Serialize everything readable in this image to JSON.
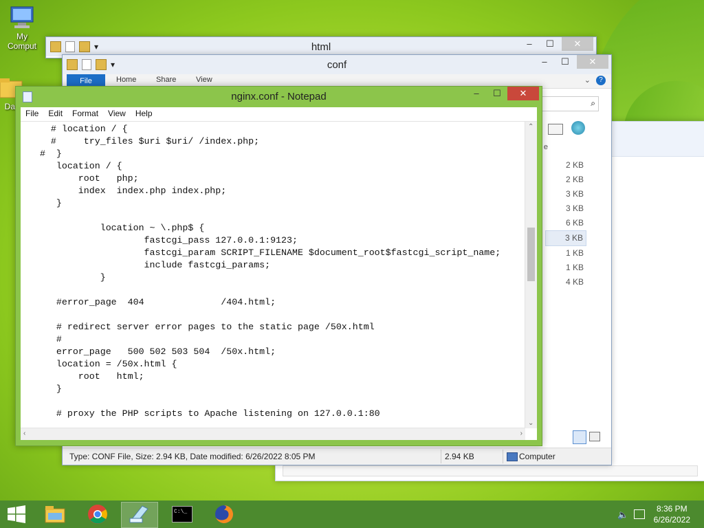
{
  "desktop": {
    "icons": [
      {
        "label": "My Comput",
        "icon": "computer-icon"
      },
      {
        "label": "Dat",
        "icon": "folder-icon"
      }
    ]
  },
  "windows": {
    "html": {
      "title": "html"
    },
    "conf": {
      "title": "conf",
      "ribbon": {
        "file": "File",
        "home": "Home",
        "share": "Share",
        "view": "View"
      },
      "column_header": "e",
      "sizes": [
        "2 KB",
        "2 KB",
        "3 KB",
        "3 KB",
        "6 KB",
        "3 KB",
        "1 KB",
        "1 KB",
        "4 KB"
      ],
      "selected_index": 5,
      "status": {
        "info": "Type: CONF File, Size: 2.94 KB, Date modified: 6/26/2022 8:05 PM",
        "size": "2.94 KB",
        "location": "Computer"
      }
    },
    "notepad": {
      "title": "nginx.conf - Notepad",
      "menu": [
        "File",
        "Edit",
        "Format",
        "View",
        "Help"
      ],
      "content": "     # location / {\n     #     try_files $uri $uri/ /index.php;\n   #  }\n      location / {\n          root   php;\n          index  index.php index.php;\n      }\n\n              location ~ \\.php$ {\n                      fastcgi_pass 127.0.0.1:9123;\n                      fastcgi_param SCRIPT_FILENAME $document_root$fastcgi_script_name;\n                      include fastcgi_params;\n              }\n\n      #error_page  404              /404.html;\n\n      # redirect server error pages to the static page /50x.html\n      #\n      error_page   500 502 503 504  /50x.html;\n      location = /50x.html {\n          root   html;\n      }\n\n      # proxy the PHP scripts to Apache listening on 127.0.0.1:80"
    }
  },
  "window_controls": {
    "minimize": "–",
    "maximize": "☐",
    "close": "✕"
  },
  "taskbar": {
    "items": [
      "start-icon",
      "file-explorer-icon",
      "chrome-icon",
      "notepad-icon",
      "cmd-icon",
      "firefox-icon"
    ],
    "cmd_text": "C:\\_",
    "clock": {
      "time": "8:36 PM",
      "date": "6/26/2022"
    }
  }
}
